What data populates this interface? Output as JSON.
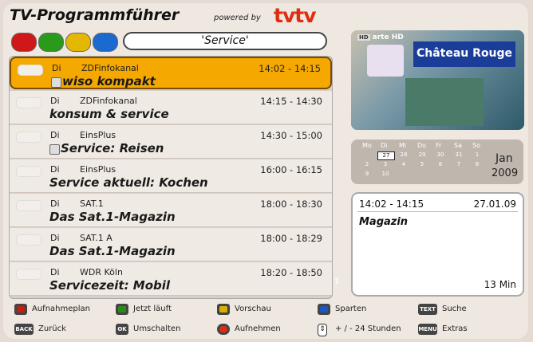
{
  "header": {
    "title": "TV-Programmführer",
    "powered_by": "powered by",
    "brand": "tvtv"
  },
  "search": {
    "value": "'Service'"
  },
  "color_buttons": [
    {
      "name": "red",
      "color": "#d01818"
    },
    {
      "name": "green",
      "color": "#2a9a1a"
    },
    {
      "name": "yellow",
      "color": "#e4b800"
    },
    {
      "name": "blue",
      "color": "#1a6ad0"
    }
  ],
  "listings": [
    {
      "day": "Di",
      "channel": "ZDFinfokanal",
      "time": "14:02 - 14:15",
      "title": "wiso kompakt",
      "selected": true,
      "has_icon": true
    },
    {
      "day": "Di",
      "channel": "ZDFinfokanal",
      "time": "14:15 - 14:30",
      "title": "konsum & service",
      "selected": false,
      "has_icon": false
    },
    {
      "day": "Di",
      "channel": "EinsPlus",
      "time": "14:30 - 15:00",
      "title": "Service: Reisen",
      "selected": false,
      "has_icon": true
    },
    {
      "day": "Di",
      "channel": "EinsPlus",
      "time": "16:00 - 16:15",
      "title": "Service aktuell: Kochen",
      "selected": false,
      "has_icon": false
    },
    {
      "day": "Di",
      "channel": "SAT.1",
      "time": "18:00 - 18:30",
      "title": "Das Sat.1-Magazin",
      "selected": false,
      "has_icon": false
    },
    {
      "day": "Di",
      "channel": "SAT.1 A",
      "time": "18:00 - 18:29",
      "title": "Das Sat.1-Magazin",
      "selected": false,
      "has_icon": false
    },
    {
      "day": "Di",
      "channel": "WDR Köln",
      "time": "18:20 - 18:50",
      "title": "Servicezeit: Mobil",
      "selected": false,
      "has_icon": false
    }
  ],
  "preview": {
    "channel": "arte HD",
    "sign": "Château Rouge"
  },
  "calendar": {
    "weekdays": [
      "Mo",
      "Di",
      "Mi",
      "Do",
      "Fr",
      "Sa",
      "So"
    ],
    "rows": [
      [
        "",
        "27",
        "28",
        "29",
        "30",
        "31",
        "1"
      ],
      [
        "2",
        "3",
        "4",
        "5",
        "6",
        "7",
        "8"
      ],
      [
        "9",
        "10",
        "",
        "",
        "",
        "",
        ""
      ]
    ],
    "selected_day": "27",
    "month": "Jan",
    "year": "2009"
  },
  "detail": {
    "time": "14:02 - 14:15",
    "date": "27.01.09",
    "genre": "Magazin",
    "duration": "13 Min"
  },
  "footer": [
    {
      "key": "red-key",
      "label": "Aufnahmeplan",
      "color": "#c02010"
    },
    {
      "key": "green-key",
      "label": "Jetzt läuft",
      "color": "#2a8a1a"
    },
    {
      "key": "yellow-key",
      "label": "Vorschau",
      "color": "#d8b000"
    },
    {
      "key": "blue-key",
      "label": "Sparten",
      "color": "#1a58c0"
    },
    {
      "key": "text-key",
      "label": "Suche",
      "badge": "TEXT"
    },
    {
      "key": "back-key",
      "label": "Zurück",
      "badge": "BACK"
    },
    {
      "key": "ok-key",
      "label": "Umschalten",
      "badge": "OK"
    },
    {
      "key": "record-key",
      "label": "Aufnehmen",
      "color": "#e02c10"
    },
    {
      "key": "updown-key",
      "label": "+ / - 24 Stunden"
    },
    {
      "key": "menu-key",
      "label": "Extras",
      "badge": "MENU"
    }
  ]
}
